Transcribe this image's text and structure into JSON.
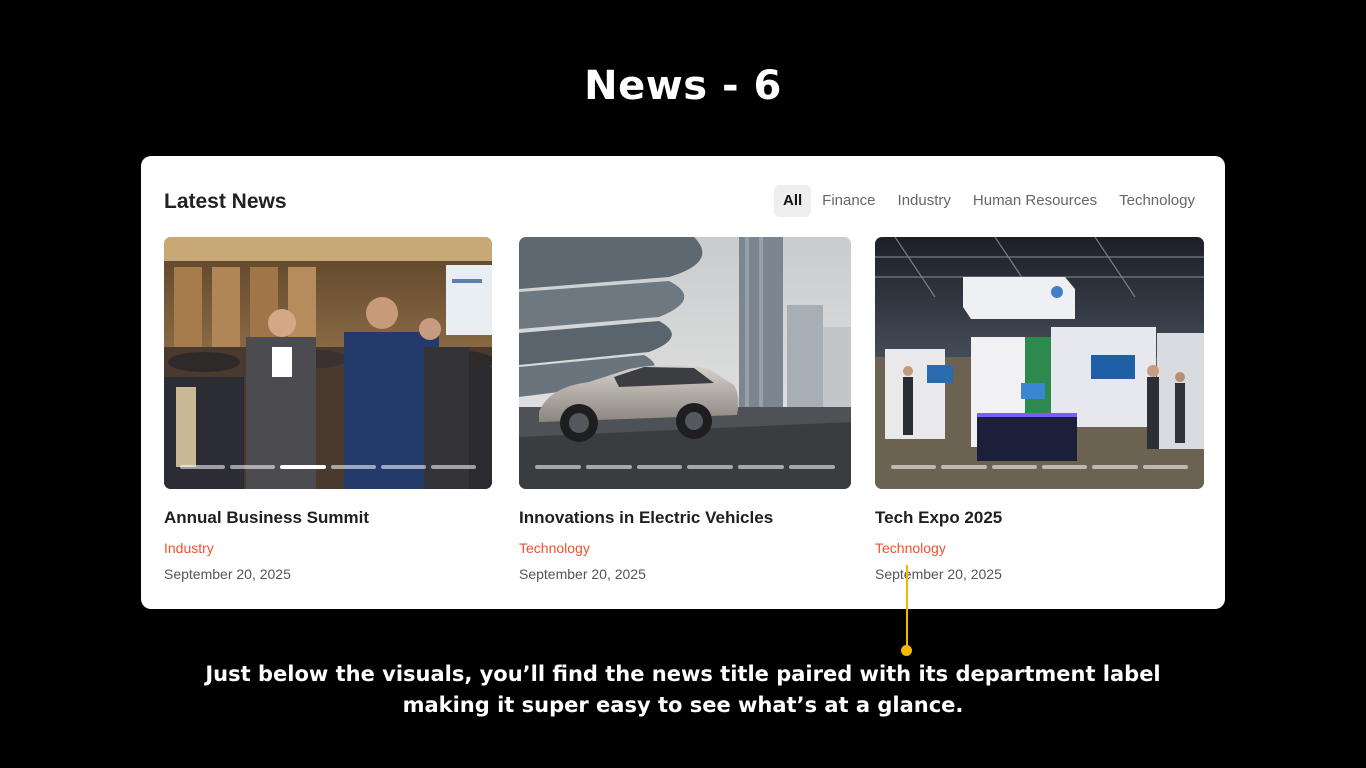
{
  "slide": {
    "title": "News - 6",
    "caption": "Just below the visuals, you’ll find the news title paired with its department label making it super easy to see what’s at a glance."
  },
  "panel": {
    "title": "Latest News",
    "tabs": [
      {
        "label": "All",
        "active": true
      },
      {
        "label": "Finance",
        "active": false
      },
      {
        "label": "Industry",
        "active": false
      },
      {
        "label": "Human Resources",
        "active": false
      },
      {
        "label": "Technology",
        "active": false
      }
    ]
  },
  "cards": [
    {
      "title": "Annual Business Summit",
      "category": "Industry",
      "date": "September 20, 2025",
      "image": "conference-photo",
      "slides": 6,
      "active_slide": 3
    },
    {
      "title": "Innovations in Electric Vehicles",
      "category": "Technology",
      "date": "September 20, 2025",
      "image": "electric-car-photo",
      "slides": 6,
      "active_slide": 0
    },
    {
      "title": "Tech Expo 2025",
      "category": "Technology",
      "date": "September 20, 2025",
      "image": "expo-hall-photo",
      "slides": 6,
      "active_slide": 0
    }
  ],
  "colors": {
    "accent": "#f0522b",
    "annotation": "#f5b800",
    "background": "#000000",
    "panel": "#ffffff"
  }
}
